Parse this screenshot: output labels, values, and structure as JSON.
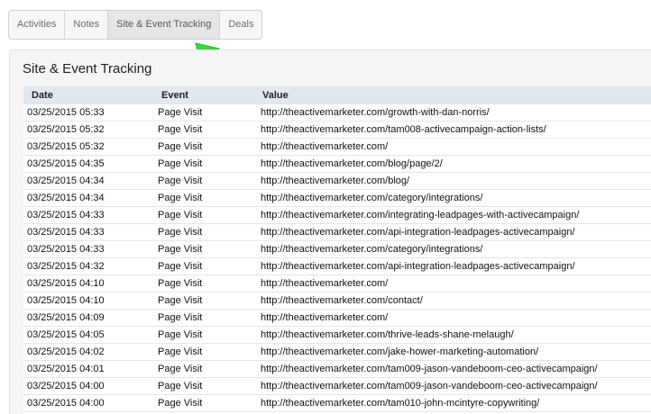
{
  "tabs": [
    {
      "label": "Activities",
      "active": false
    },
    {
      "label": "Notes",
      "active": false
    },
    {
      "label": "Site & Event Tracking",
      "active": true
    },
    {
      "label": "Deals",
      "active": false
    }
  ],
  "annotation": {
    "color": "#3ed43e",
    "icon": "arrow-icon"
  },
  "panel": {
    "title": "Site & Event Tracking",
    "columns": {
      "date": "Date",
      "event": "Event",
      "value": "Value"
    },
    "rows": [
      {
        "date": "03/25/2015 05:33",
        "event": "Page Visit",
        "value": "http://theactivemarketer.com/growth-with-dan-norris/"
      },
      {
        "date": "03/25/2015 05:32",
        "event": "Page Visit",
        "value": "http://theactivemarketer.com/tam008-activecampaign-action-lists/"
      },
      {
        "date": "03/25/2015 05:32",
        "event": "Page Visit",
        "value": "http://theactivemarketer.com/"
      },
      {
        "date": "03/25/2015 04:35",
        "event": "Page Visit",
        "value": "http://theactivemarketer.com/blog/page/2/"
      },
      {
        "date": "03/25/2015 04:34",
        "event": "Page Visit",
        "value": "http://theactivemarketer.com/blog/"
      },
      {
        "date": "03/25/2015 04:34",
        "event": "Page Visit",
        "value": "http://theactivemarketer.com/category/integrations/"
      },
      {
        "date": "03/25/2015 04:33",
        "event": "Page Visit",
        "value": "http://theactivemarketer.com/integrating-leadpages-with-activecampaign/"
      },
      {
        "date": "03/25/2015 04:33",
        "event": "Page Visit",
        "value": "http://theactivemarketer.com/api-integration-leadpages-activecampaign/"
      },
      {
        "date": "03/25/2015 04:33",
        "event": "Page Visit",
        "value": "http://theactivemarketer.com/category/integrations/"
      },
      {
        "date": "03/25/2015 04:32",
        "event": "Page Visit",
        "value": "http://theactivemarketer.com/api-integration-leadpages-activecampaign/"
      },
      {
        "date": "03/25/2015 04:10",
        "event": "Page Visit",
        "value": "http://theactivemarketer.com/"
      },
      {
        "date": "03/25/2015 04:10",
        "event": "Page Visit",
        "value": "http://theactivemarketer.com/contact/"
      },
      {
        "date": "03/25/2015 04:09",
        "event": "Page Visit",
        "value": "http://theactivemarketer.com/"
      },
      {
        "date": "03/25/2015 04:05",
        "event": "Page Visit",
        "value": "http://theactivemarketer.com/thrive-leads-shane-melaugh/"
      },
      {
        "date": "03/25/2015 04:02",
        "event": "Page Visit",
        "value": "http://theactivemarketer.com/jake-hower-marketing-automation/"
      },
      {
        "date": "03/25/2015 04:01",
        "event": "Page Visit",
        "value": "http://theactivemarketer.com/tam009-jason-vandeboom-ceo-activecampaign/"
      },
      {
        "date": "03/25/2015 04:00",
        "event": "Page Visit",
        "value": "http://theactivemarketer.com/tam009-jason-vandeboom-ceo-activecampaign/"
      },
      {
        "date": "03/25/2015 04:00",
        "event": "Page Visit",
        "value": "http://theactivemarketer.com/tam010-john-mcintyre-copywriting/"
      }
    ]
  }
}
